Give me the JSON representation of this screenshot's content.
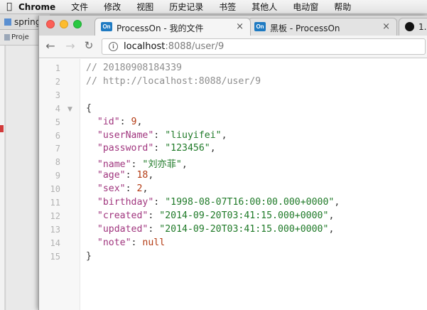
{
  "menubar": {
    "apple": "",
    "items": [
      "Chrome",
      "文件",
      "修改",
      "视图",
      "历史记录",
      "书签",
      "其他人",
      "电动窗",
      "帮助"
    ]
  },
  "ide": {
    "title": "springb",
    "tab": "Proje"
  },
  "tabs": [
    {
      "favicon": "On",
      "title": "ProcessOn - 我的文件",
      "close": "×"
    },
    {
      "favicon": "On",
      "title": "黑板 - ProcessOn",
      "close": "×"
    },
    {
      "favicon": "github-icon",
      "title": "1."
    }
  ],
  "toolbar": {
    "back": "←",
    "forward": "→",
    "reload": "↻",
    "info": "i",
    "url_host": "localhost",
    "url_path": ":8088/user/9"
  },
  "viewer": {
    "line_numbers": [
      "1",
      "2",
      "3",
      "4",
      "5",
      "6",
      "7",
      "8",
      "9",
      "10",
      "11",
      "12",
      "13",
      "14",
      "15"
    ],
    "comment1": "// 20180908184339",
    "comment2": "// http://localhost:8088/user/9",
    "open_brace": "{",
    "close_brace": "}",
    "fields": [
      {
        "key": "\"id\"",
        "value": "9",
        "kind": "n",
        "comma": ","
      },
      {
        "key": "\"userName\"",
        "value": "\"liuyifei\"",
        "kind": "s",
        "comma": ","
      },
      {
        "key": "\"password\"",
        "value": "\"123456\"",
        "kind": "s",
        "comma": ","
      },
      {
        "key": "\"name\"",
        "value": "\"刘亦菲\"",
        "kind": "s",
        "comma": ","
      },
      {
        "key": "\"age\"",
        "value": "18",
        "kind": "n",
        "comma": ","
      },
      {
        "key": "\"sex\"",
        "value": "2",
        "kind": "n",
        "comma": ","
      },
      {
        "key": "\"birthday\"",
        "value": "\"1998-08-07T16:00:00.000+0000\"",
        "kind": "s",
        "comma": ","
      },
      {
        "key": "\"created\"",
        "value": "\"2014-09-20T03:41:15.000+0000\"",
        "kind": "s",
        "comma": ","
      },
      {
        "key": "\"updated\"",
        "value": "\"2014-09-20T03:41:15.000+0000\"",
        "kind": "s",
        "comma": ","
      },
      {
        "key": "\"note\"",
        "value": "null",
        "kind": "n",
        "comma": ""
      }
    ]
  }
}
